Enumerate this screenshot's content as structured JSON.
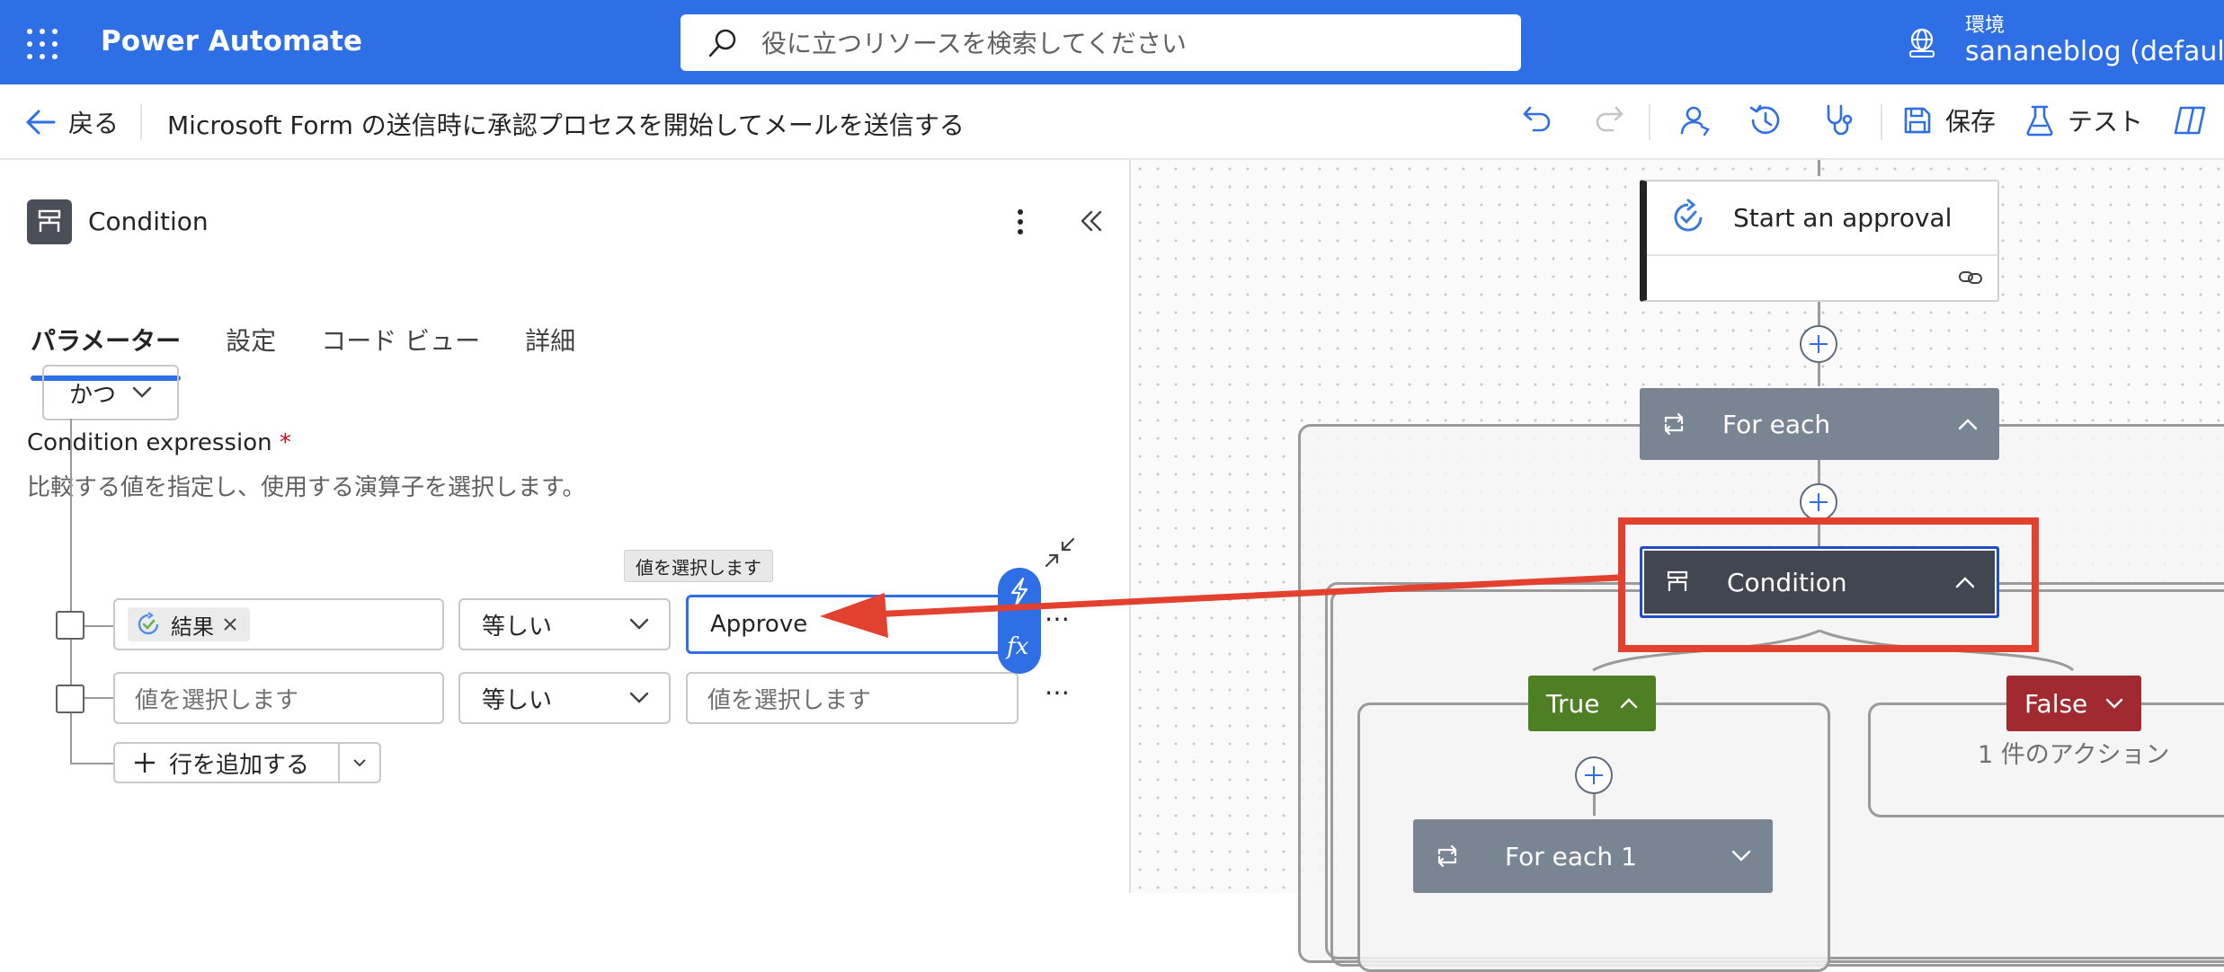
{
  "topbar": {
    "app_name": "Power Automate",
    "search_placeholder": "役に立つリソースを検索してください",
    "env_label": "環境",
    "env_value": "sananeblog (default)"
  },
  "cmdbar": {
    "back_label": "戻る",
    "flow_title": "Microsoft Form の送信時に承認プロセスを開始してメールを送信する",
    "save_label": "保存",
    "test_label": "テスト"
  },
  "panel": {
    "title": "Condition",
    "tabs": [
      "パラメーター",
      "設定",
      "コード ビュー",
      "詳細"
    ],
    "expression_label": "Condition expression",
    "required_mark": "*",
    "expression_desc": "比較する値を指定し、使用する演算子を選択します。",
    "group_operator": "かつ",
    "rows": [
      {
        "left_token": "結果",
        "operator": "等しい",
        "right_value": "Approve"
      },
      {
        "left_placeholder": "値を選択します",
        "operator": "等しい",
        "right_placeholder": "値を選択します"
      }
    ],
    "tooltip": "値を選択します",
    "add_row_label": "行を追加する"
  },
  "canvas": {
    "start_approval": "Start an approval",
    "for_each": "For each",
    "condition": "Condition",
    "true_label": "True",
    "false_label": "False",
    "false_actions": "1 件のアクション",
    "for_each_1": "For each 1"
  },
  "colors": {
    "brand": "#2f6fe6",
    "true_branch": "#4f7f25",
    "false_branch": "#a12a30",
    "highlight": "#e2412f"
  }
}
